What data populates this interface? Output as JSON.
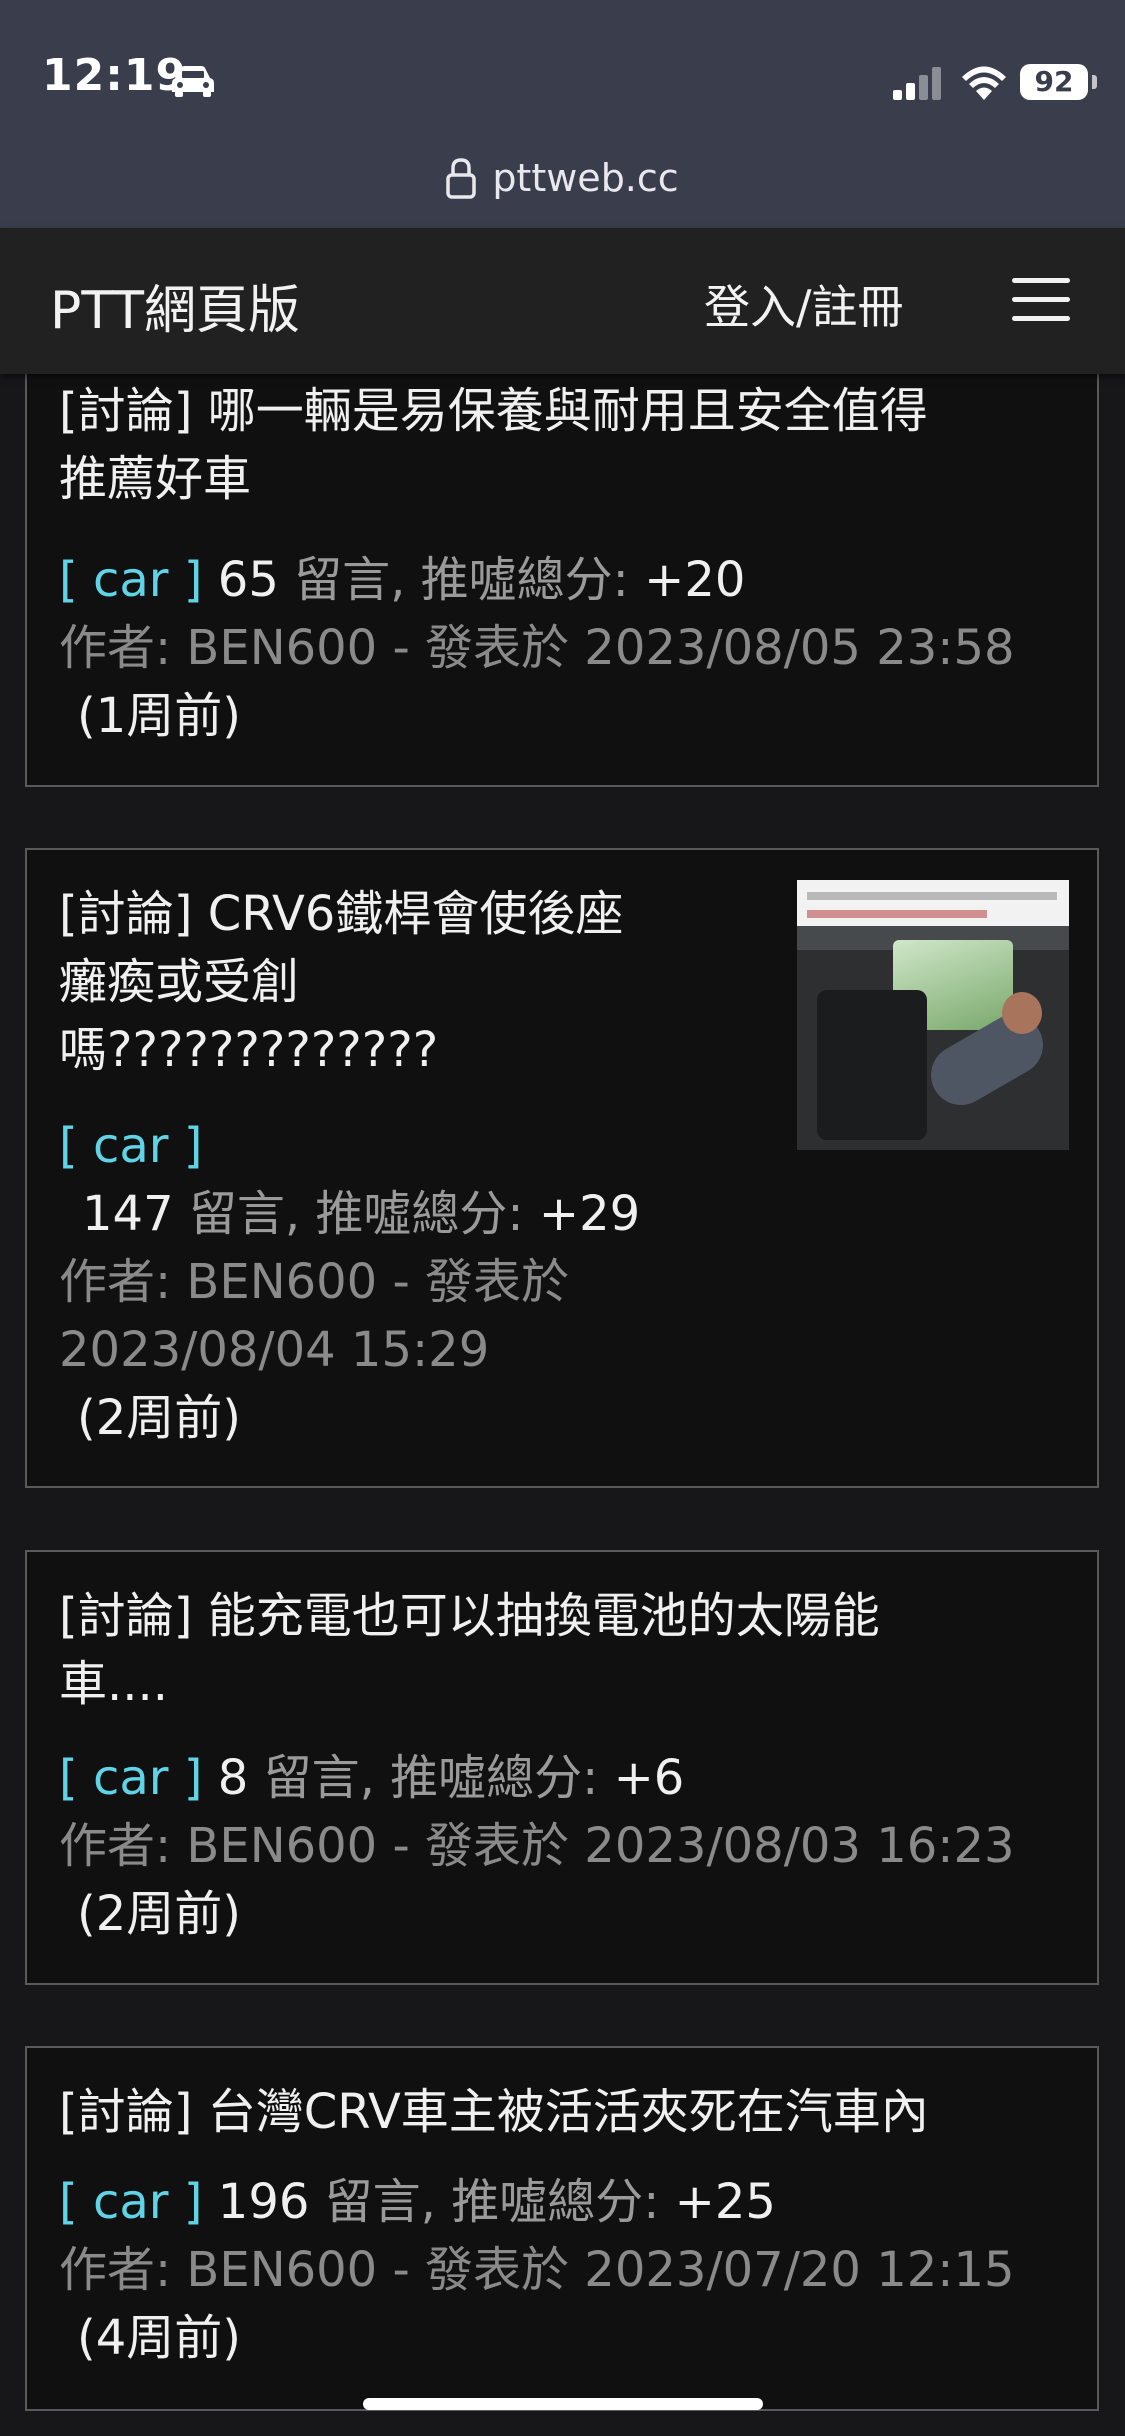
{
  "status_bar": {
    "time": "12:19",
    "battery": "92"
  },
  "browser": {
    "url": "pttweb.cc"
  },
  "header": {
    "site_title": "PTT網頁版",
    "login_label": "登入/註冊"
  },
  "articles": [
    {
      "title_lines": [
        "[討論] 哪一輛是易保養與耐用且安全值得",
        "推薦好車"
      ],
      "board": "[ car ]",
      "comments": "65",
      "comments_label": "留言, 推噓總分:",
      "score": "+20",
      "author_line": "作者: BEN600 - 發表於 2023/08/05 23:58",
      "ago": "(1周前)"
    },
    {
      "title_lines": [
        "[討論] CRV6鐵桿會使後座",
        "癱瘓或受創",
        "嗎?????????????"
      ],
      "board": "[ car ]",
      "comments": "147",
      "comments_label": "留言, 推噓總分:",
      "score": "+29",
      "author_line_1": "作者: BEN600 - 發表於",
      "author_line_2": "2023/08/04 15:29",
      "ago": "(2周前)"
    },
    {
      "title_lines": [
        "[討論] 能充電也可以抽換電池的太陽能",
        "車...."
      ],
      "board": "[ car ]",
      "comments": "8",
      "comments_label": "留言, 推噓總分:",
      "score": "+6",
      "author_line": "作者: BEN600 - 發表於 2023/08/03 16:23",
      "ago": "(2周前)"
    },
    {
      "title_lines": [
        "[討論] 台灣CRV車主被活活夾死在汽車內"
      ],
      "board": "[ car ]",
      "comments": "196",
      "comments_label": "留言, 推噓總分:",
      "score": "+25",
      "author_line": "作者: BEN600 - 發表於 2023/07/20 12:15",
      "ago": "(4周前)"
    }
  ]
}
